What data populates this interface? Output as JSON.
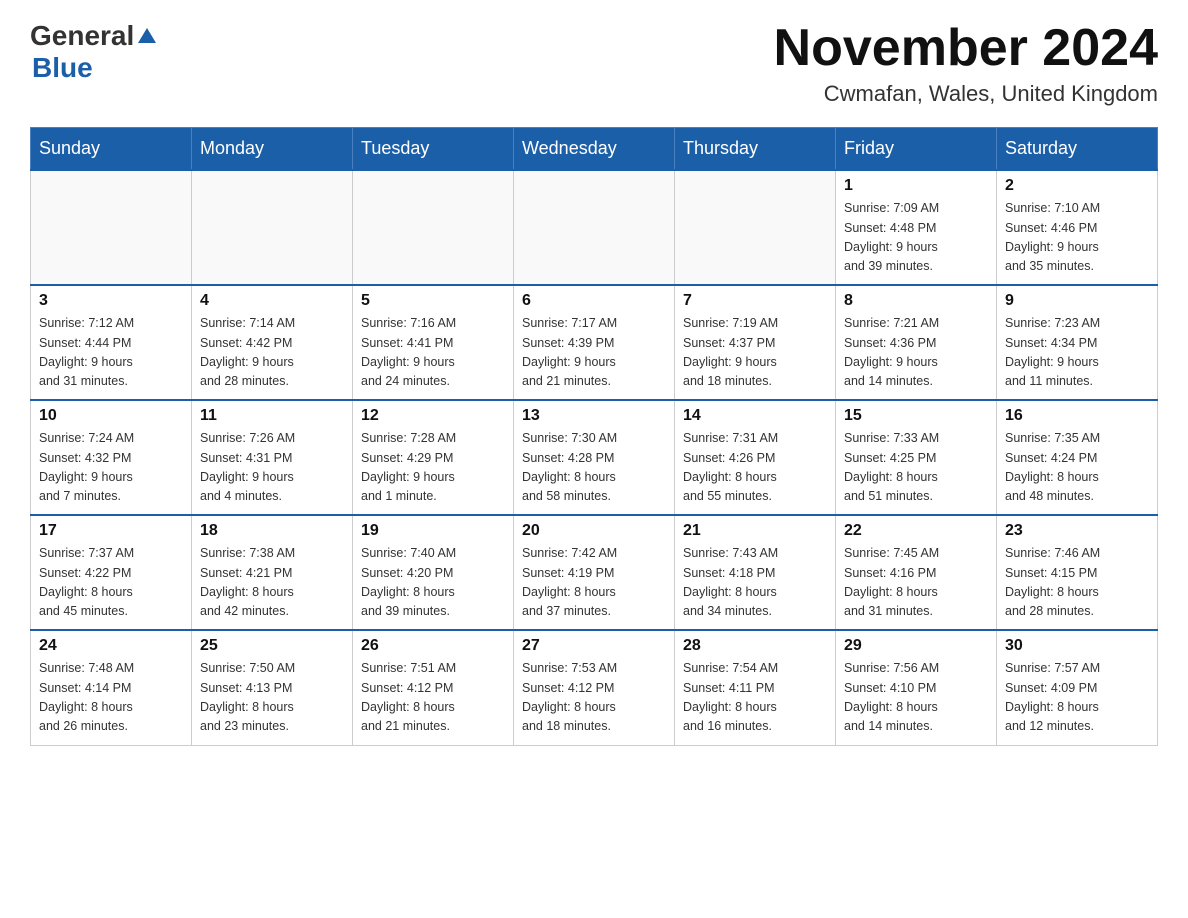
{
  "header": {
    "logo_part1": "General",
    "logo_part2": "Blue",
    "month_title": "November 2024",
    "location": "Cwmafan, Wales, United Kingdom"
  },
  "weekdays": [
    "Sunday",
    "Monday",
    "Tuesday",
    "Wednesday",
    "Thursday",
    "Friday",
    "Saturday"
  ],
  "weeks": [
    [
      {
        "day": "",
        "info": ""
      },
      {
        "day": "",
        "info": ""
      },
      {
        "day": "",
        "info": ""
      },
      {
        "day": "",
        "info": ""
      },
      {
        "day": "",
        "info": ""
      },
      {
        "day": "1",
        "info": "Sunrise: 7:09 AM\nSunset: 4:48 PM\nDaylight: 9 hours\nand 39 minutes."
      },
      {
        "day": "2",
        "info": "Sunrise: 7:10 AM\nSunset: 4:46 PM\nDaylight: 9 hours\nand 35 minutes."
      }
    ],
    [
      {
        "day": "3",
        "info": "Sunrise: 7:12 AM\nSunset: 4:44 PM\nDaylight: 9 hours\nand 31 minutes."
      },
      {
        "day": "4",
        "info": "Sunrise: 7:14 AM\nSunset: 4:42 PM\nDaylight: 9 hours\nand 28 minutes."
      },
      {
        "day": "5",
        "info": "Sunrise: 7:16 AM\nSunset: 4:41 PM\nDaylight: 9 hours\nand 24 minutes."
      },
      {
        "day": "6",
        "info": "Sunrise: 7:17 AM\nSunset: 4:39 PM\nDaylight: 9 hours\nand 21 minutes."
      },
      {
        "day": "7",
        "info": "Sunrise: 7:19 AM\nSunset: 4:37 PM\nDaylight: 9 hours\nand 18 minutes."
      },
      {
        "day": "8",
        "info": "Sunrise: 7:21 AM\nSunset: 4:36 PM\nDaylight: 9 hours\nand 14 minutes."
      },
      {
        "day": "9",
        "info": "Sunrise: 7:23 AM\nSunset: 4:34 PM\nDaylight: 9 hours\nand 11 minutes."
      }
    ],
    [
      {
        "day": "10",
        "info": "Sunrise: 7:24 AM\nSunset: 4:32 PM\nDaylight: 9 hours\nand 7 minutes."
      },
      {
        "day": "11",
        "info": "Sunrise: 7:26 AM\nSunset: 4:31 PM\nDaylight: 9 hours\nand 4 minutes."
      },
      {
        "day": "12",
        "info": "Sunrise: 7:28 AM\nSunset: 4:29 PM\nDaylight: 9 hours\nand 1 minute."
      },
      {
        "day": "13",
        "info": "Sunrise: 7:30 AM\nSunset: 4:28 PM\nDaylight: 8 hours\nand 58 minutes."
      },
      {
        "day": "14",
        "info": "Sunrise: 7:31 AM\nSunset: 4:26 PM\nDaylight: 8 hours\nand 55 minutes."
      },
      {
        "day": "15",
        "info": "Sunrise: 7:33 AM\nSunset: 4:25 PM\nDaylight: 8 hours\nand 51 minutes."
      },
      {
        "day": "16",
        "info": "Sunrise: 7:35 AM\nSunset: 4:24 PM\nDaylight: 8 hours\nand 48 minutes."
      }
    ],
    [
      {
        "day": "17",
        "info": "Sunrise: 7:37 AM\nSunset: 4:22 PM\nDaylight: 8 hours\nand 45 minutes."
      },
      {
        "day": "18",
        "info": "Sunrise: 7:38 AM\nSunset: 4:21 PM\nDaylight: 8 hours\nand 42 minutes."
      },
      {
        "day": "19",
        "info": "Sunrise: 7:40 AM\nSunset: 4:20 PM\nDaylight: 8 hours\nand 39 minutes."
      },
      {
        "day": "20",
        "info": "Sunrise: 7:42 AM\nSunset: 4:19 PM\nDaylight: 8 hours\nand 37 minutes."
      },
      {
        "day": "21",
        "info": "Sunrise: 7:43 AM\nSunset: 4:18 PM\nDaylight: 8 hours\nand 34 minutes."
      },
      {
        "day": "22",
        "info": "Sunrise: 7:45 AM\nSunset: 4:16 PM\nDaylight: 8 hours\nand 31 minutes."
      },
      {
        "day": "23",
        "info": "Sunrise: 7:46 AM\nSunset: 4:15 PM\nDaylight: 8 hours\nand 28 minutes."
      }
    ],
    [
      {
        "day": "24",
        "info": "Sunrise: 7:48 AM\nSunset: 4:14 PM\nDaylight: 8 hours\nand 26 minutes."
      },
      {
        "day": "25",
        "info": "Sunrise: 7:50 AM\nSunset: 4:13 PM\nDaylight: 8 hours\nand 23 minutes."
      },
      {
        "day": "26",
        "info": "Sunrise: 7:51 AM\nSunset: 4:12 PM\nDaylight: 8 hours\nand 21 minutes."
      },
      {
        "day": "27",
        "info": "Sunrise: 7:53 AM\nSunset: 4:12 PM\nDaylight: 8 hours\nand 18 minutes."
      },
      {
        "day": "28",
        "info": "Sunrise: 7:54 AM\nSunset: 4:11 PM\nDaylight: 8 hours\nand 16 minutes."
      },
      {
        "day": "29",
        "info": "Sunrise: 7:56 AM\nSunset: 4:10 PM\nDaylight: 8 hours\nand 14 minutes."
      },
      {
        "day": "30",
        "info": "Sunrise: 7:57 AM\nSunset: 4:09 PM\nDaylight: 8 hours\nand 12 minutes."
      }
    ]
  ]
}
